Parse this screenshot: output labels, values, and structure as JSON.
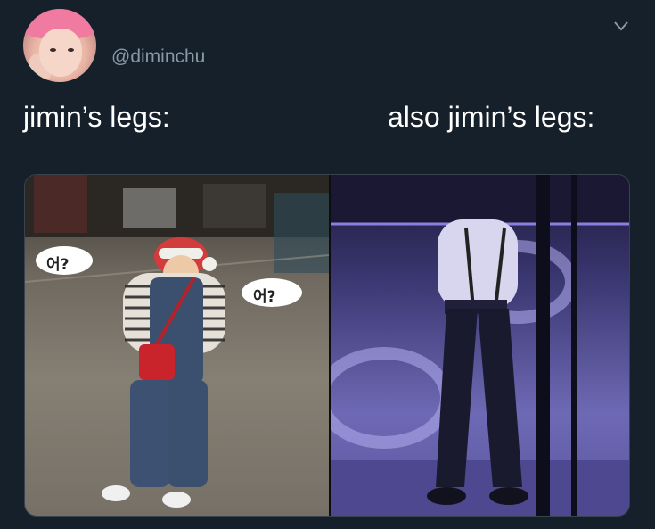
{
  "tweet": {
    "handle": "@diminchu",
    "caption_left": "jimin’s legs:",
    "caption_right": "also jimin’s legs:"
  },
  "media": {
    "left_bubble_1": "어?",
    "left_bubble_2": "어?"
  },
  "icons": {
    "menu": "chevron-down-icon",
    "avatar": "avatar"
  },
  "colors": {
    "background": "#15202b",
    "handle": "#8899a6",
    "text": "#ffffff"
  }
}
